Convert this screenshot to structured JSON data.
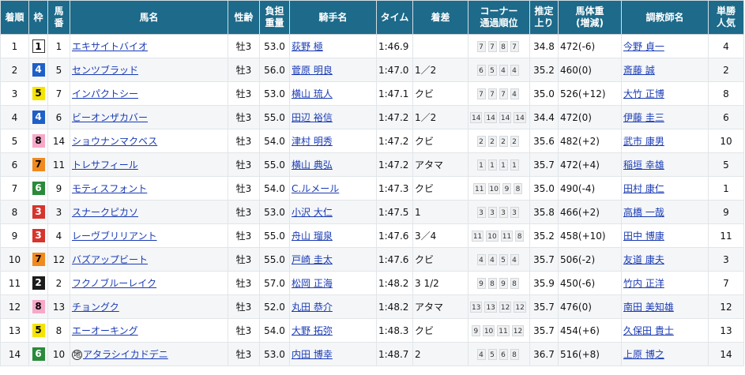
{
  "headers": {
    "rank": [
      "着順"
    ],
    "frame": [
      "枠"
    ],
    "number": [
      "馬",
      "番"
    ],
    "horse": [
      "馬名"
    ],
    "sexage": [
      "性齢"
    ],
    "weight": [
      "負担",
      "重量"
    ],
    "jockey": [
      "騎手名"
    ],
    "time": [
      "タイム"
    ],
    "margin": [
      "着差"
    ],
    "corner": [
      "コーナー",
      "通過順位"
    ],
    "last3f": [
      "推定",
      "上り"
    ],
    "bodyweight": [
      "馬体重",
      "(増減)"
    ],
    "trainer": [
      "調教師名"
    ],
    "popularity": [
      "単勝",
      "人気"
    ]
  },
  "frame_colors": {
    "1": "#ffffff",
    "2": "#1c1c1c",
    "3": "#d6342c",
    "4": "#1e5fc8",
    "5": "#f5e400",
    "6": "#2a8a3a",
    "7": "#f08a1e",
    "8": "#f7a8c8"
  },
  "rows": [
    {
      "rank": "1",
      "frame": "1",
      "number": "1",
      "mark": "",
      "horse": "エキサイトバイオ",
      "sexage": "牡3",
      "weight": "53.0",
      "jockey": "荻野 極",
      "time": "1:46.9",
      "margin": "",
      "corner": [
        "7",
        "7",
        "8",
        "7"
      ],
      "last3f": "34.8",
      "bodyweight": "472(-6)",
      "trainer": "今野 貞一",
      "popularity": "4"
    },
    {
      "rank": "2",
      "frame": "4",
      "number": "5",
      "mark": "",
      "horse": "センツブラッド",
      "sexage": "牡3",
      "weight": "56.0",
      "jockey": "菅原 明良",
      "time": "1:47.0",
      "margin": "1／2",
      "corner": [
        "6",
        "5",
        "4",
        "4"
      ],
      "last3f": "35.2",
      "bodyweight": "460(0)",
      "trainer": "斎藤 誠",
      "popularity": "2"
    },
    {
      "rank": "3",
      "frame": "5",
      "number": "7",
      "mark": "",
      "horse": "インパクトシー",
      "sexage": "牡3",
      "weight": "53.0",
      "jockey": "横山 琉人",
      "time": "1:47.1",
      "margin": "クビ",
      "corner": [
        "7",
        "7",
        "7",
        "4"
      ],
      "last3f": "35.0",
      "bodyweight": "526(+12)",
      "trainer": "大竹 正博",
      "popularity": "8"
    },
    {
      "rank": "4",
      "frame": "4",
      "number": "6",
      "mark": "",
      "horse": "ビーオンザカバー",
      "sexage": "牡3",
      "weight": "55.0",
      "jockey": "田辺 裕信",
      "time": "1:47.2",
      "margin": "1／2",
      "corner": [
        "14",
        "14",
        "14",
        "14"
      ],
      "last3f": "34.4",
      "bodyweight": "472(0)",
      "trainer": "伊藤 圭三",
      "popularity": "6"
    },
    {
      "rank": "5",
      "frame": "8",
      "number": "14",
      "mark": "",
      "horse": "ショウナンマクベス",
      "sexage": "牡3",
      "weight": "54.0",
      "jockey": "津村 明秀",
      "time": "1:47.2",
      "margin": "クビ",
      "corner": [
        "2",
        "2",
        "2",
        "2"
      ],
      "last3f": "35.6",
      "bodyweight": "482(+2)",
      "trainer": "武市 康男",
      "popularity": "10"
    },
    {
      "rank": "6",
      "frame": "7",
      "number": "11",
      "mark": "",
      "horse": "トレサフィール",
      "sexage": "牡3",
      "weight": "55.0",
      "jockey": "横山 典弘",
      "time": "1:47.2",
      "margin": "アタマ",
      "corner": [
        "1",
        "1",
        "1",
        "1"
      ],
      "last3f": "35.7",
      "bodyweight": "472(+4)",
      "trainer": "稲垣 幸雄",
      "popularity": "5"
    },
    {
      "rank": "7",
      "frame": "6",
      "number": "9",
      "mark": "",
      "horse": "モティスフォント",
      "sexage": "牡3",
      "weight": "54.0",
      "jockey": "C.ルメール",
      "time": "1:47.3",
      "margin": "クビ",
      "corner": [
        "11",
        "10",
        "9",
        "8"
      ],
      "last3f": "35.0",
      "bodyweight": "490(-4)",
      "trainer": "田村 康仁",
      "popularity": "1"
    },
    {
      "rank": "8",
      "frame": "3",
      "number": "3",
      "mark": "",
      "horse": "スナークピカソ",
      "sexage": "牡3",
      "weight": "53.0",
      "jockey": "小沢 大仁",
      "time": "1:47.5",
      "margin": "1",
      "corner": [
        "3",
        "3",
        "3",
        "3"
      ],
      "last3f": "35.8",
      "bodyweight": "466(+2)",
      "trainer": "高橋 一哉",
      "popularity": "9"
    },
    {
      "rank": "9",
      "frame": "3",
      "number": "4",
      "mark": "",
      "horse": "レーヴブリリアント",
      "sexage": "牡3",
      "weight": "55.0",
      "jockey": "舟山 瑠泉",
      "time": "1:47.6",
      "margin": "3／4",
      "corner": [
        "11",
        "10",
        "11",
        "8"
      ],
      "last3f": "35.2",
      "bodyweight": "458(+10)",
      "trainer": "田中 博康",
      "popularity": "11"
    },
    {
      "rank": "10",
      "frame": "7",
      "number": "12",
      "mark": "",
      "horse": "バズアップビート",
      "sexage": "牡3",
      "weight": "55.0",
      "jockey": "戸崎 圭太",
      "time": "1:47.6",
      "margin": "クビ",
      "corner": [
        "4",
        "4",
        "5",
        "4"
      ],
      "last3f": "35.7",
      "bodyweight": "506(-2)",
      "trainer": "友道 康夫",
      "popularity": "3"
    },
    {
      "rank": "11",
      "frame": "2",
      "number": "2",
      "mark": "",
      "horse": "フクノブルーレイク",
      "sexage": "牡3",
      "weight": "57.0",
      "jockey": "松岡 正海",
      "time": "1:48.2",
      "margin": "3 1/2",
      "corner": [
        "9",
        "8",
        "9",
        "8"
      ],
      "last3f": "35.9",
      "bodyweight": "450(-6)",
      "trainer": "竹内 正洋",
      "popularity": "7"
    },
    {
      "rank": "12",
      "frame": "8",
      "number": "13",
      "mark": "",
      "horse": "チョングク",
      "sexage": "牡3",
      "weight": "52.0",
      "jockey": "丸田 恭介",
      "time": "1:48.2",
      "margin": "アタマ",
      "corner": [
        "13",
        "13",
        "12",
        "12"
      ],
      "last3f": "35.7",
      "bodyweight": "476(0)",
      "trainer": "南田 美知雄",
      "popularity": "12"
    },
    {
      "rank": "13",
      "frame": "5",
      "number": "8",
      "mark": "",
      "horse": "エーオーキング",
      "sexage": "牡3",
      "weight": "54.0",
      "jockey": "大野 拓弥",
      "time": "1:48.3",
      "margin": "クビ",
      "corner": [
        "9",
        "10",
        "11",
        "12"
      ],
      "last3f": "35.7",
      "bodyweight": "454(+6)",
      "trainer": "久保田 貴士",
      "popularity": "13"
    },
    {
      "rank": "14",
      "frame": "6",
      "number": "10",
      "mark": "地",
      "horse": "アタラシイカドデニ",
      "sexage": "牡3",
      "weight": "53.0",
      "jockey": "内田 博幸",
      "time": "1:48.7",
      "margin": "2",
      "corner": [
        "4",
        "5",
        "6",
        "8"
      ],
      "last3f": "36.7",
      "bodyweight": "516(+8)",
      "trainer": "上原 博之",
      "popularity": "14"
    }
  ]
}
